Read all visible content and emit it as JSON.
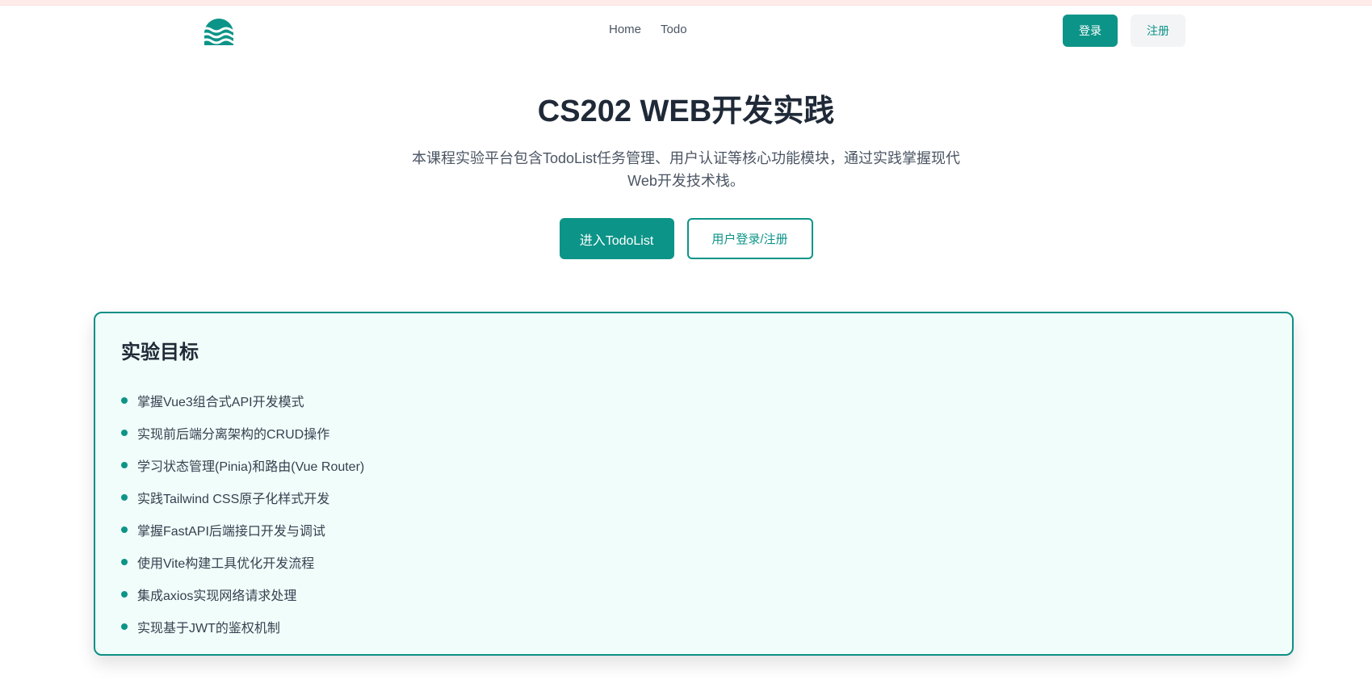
{
  "nav": {
    "items": [
      {
        "label": "Home"
      },
      {
        "label": "Todo"
      }
    ]
  },
  "auth": {
    "login_label": "登录",
    "register_label": "注册"
  },
  "hero": {
    "title": "CS202 WEB开发实践",
    "description": "本课程实验平台包含TodoList任务管理、用户认证等核心功能模块，通过实践掌握现代Web开发技术栈。",
    "primary_button": "进入TodoList",
    "secondary_button": "用户登录/注册"
  },
  "goals": {
    "title": "实验目标",
    "items": [
      "掌握Vue3组合式API开发模式",
      "实现前后端分离架构的CRUD操作",
      "学习状态管理(Pinia)和路由(Vue Router)",
      "实践Tailwind CSS原子化样式开发",
      "掌握FastAPI后端接口开发与调试",
      "使用Vite构建工具优化开发流程",
      "集成axios实现网络请求处理",
      "实现基于JWT的鉴权机制"
    ]
  },
  "colors": {
    "accent": "#0d9488",
    "card_bg": "#f0fdfa",
    "text": "#1f2937"
  },
  "icons": {
    "logo": "waves-logo-icon"
  }
}
